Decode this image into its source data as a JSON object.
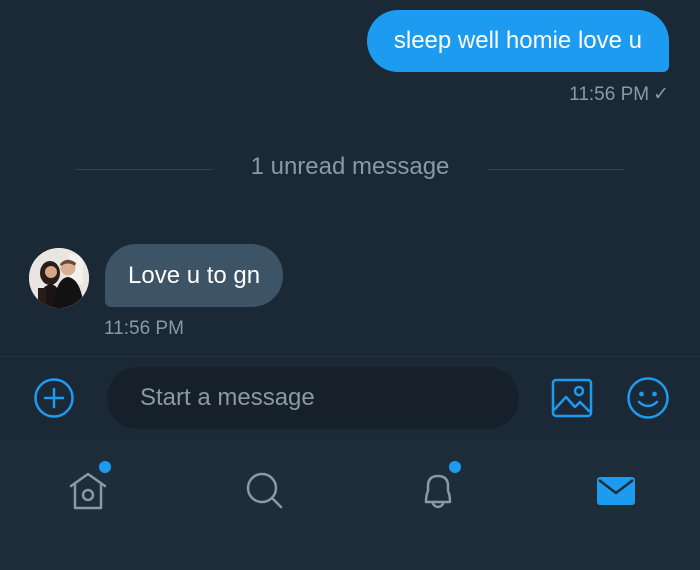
{
  "thread": {
    "outgoing": {
      "text": "sleep well homie love u",
      "time": "11:56 PM",
      "status": "✓"
    },
    "divider": "1 unread message",
    "incoming": {
      "text": "Love u to gn",
      "time": "11:56 PM"
    }
  },
  "composer": {
    "placeholder": "Start a message"
  },
  "nav": {
    "items": [
      {
        "icon": "home-icon",
        "has_badge": true
      },
      {
        "icon": "search-icon",
        "has_badge": false
      },
      {
        "icon": "bell-icon",
        "has_badge": true
      },
      {
        "icon": "mail-icon",
        "has_badge": false,
        "active": true
      }
    ]
  },
  "colors": {
    "accent": "#1d9bf0",
    "background": "#15202b",
    "thread_bg": "#1b2836",
    "incoming_bubble": "#3d5466",
    "muted_text": "#8b98a5",
    "nav_bg": "#1f2d3b"
  }
}
